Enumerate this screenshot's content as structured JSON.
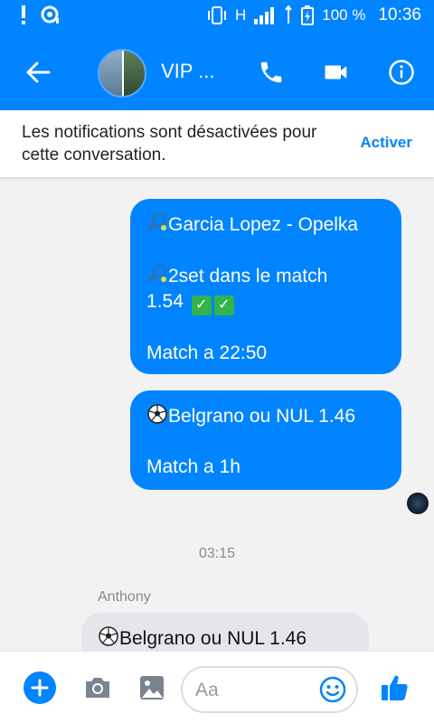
{
  "status_bar": {
    "battery": "100 %",
    "time": "10:36",
    "network": "H"
  },
  "header": {
    "title": "VIP ...",
    "icons": [
      "back-arrow-icon",
      "phone-icon",
      "video-camera-icon",
      "info-icon"
    ]
  },
  "notification": {
    "text": "Les notifications sont désactivées pour cette conversation.",
    "action": "Activer"
  },
  "messages": {
    "out1": {
      "line1": "Garcia Lopez - Opelka",
      "line2": "2set dans le match",
      "line3": "1.54",
      "line4": "Match a 22:50"
    },
    "out2": {
      "line1": "Belgrano ou NUL 1.46",
      "line2": "Match a 1h"
    },
    "timestamp": "03:15",
    "sender": "Anthony",
    "in1": {
      "line1": "Belgrano ou NUL 1.46"
    }
  },
  "composer": {
    "placeholder": "Aa"
  },
  "colors": {
    "brand": "#0084ff",
    "incoming_bubble": "#e4e6eb",
    "check": "#34b34a"
  }
}
